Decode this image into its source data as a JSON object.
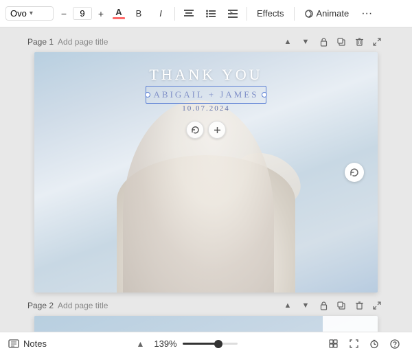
{
  "toolbar": {
    "font_name": "Ovo",
    "font_size": "9",
    "bold_label": "B",
    "italic_label": "I",
    "align_label": "≡",
    "list_label": "☰",
    "indent_label": "⇌",
    "effects_label": "Effects",
    "animate_label": "Animate",
    "more_label": "•••",
    "color_letter": "A"
  },
  "page1": {
    "label": "Page 1",
    "add_title": "Add page title",
    "canvas": {
      "thank_you": "THANK YOU",
      "names": "ABIGAIL + JAMES",
      "date": "10.07.2024"
    }
  },
  "page2": {
    "label": "Page 2",
    "add_title": "Add page title"
  },
  "bottom": {
    "notes_label": "Notes",
    "zoom_level": "139%"
  }
}
